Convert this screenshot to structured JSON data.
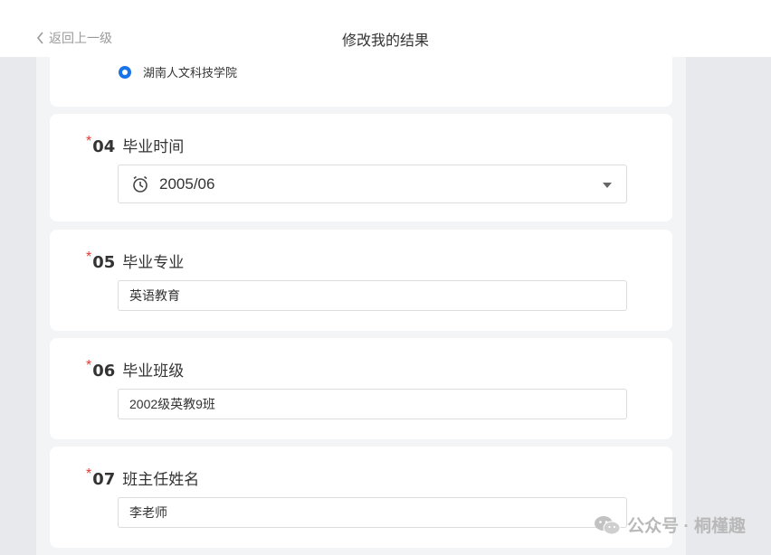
{
  "header": {
    "back_label": "返回上一级",
    "title": "修改我的结果"
  },
  "q03": {
    "selected_option": "湖南人文科技学院"
  },
  "q04": {
    "number": "04",
    "label": "毕业时间",
    "value": "2005/06"
  },
  "q05": {
    "number": "05",
    "label": "毕业专业",
    "value": "英语教育"
  },
  "q06": {
    "number": "06",
    "label": "毕业班级",
    "value": "2002级英教9班"
  },
  "q07": {
    "number": "07",
    "label": "班主任姓名",
    "value": "李老师"
  },
  "required_mark": "*",
  "watermark": {
    "text": "公众号 · 桐槿趣",
    "icon": "wechat-icon"
  },
  "colors": {
    "accent": "#1a73e8",
    "required": "#e53935"
  }
}
